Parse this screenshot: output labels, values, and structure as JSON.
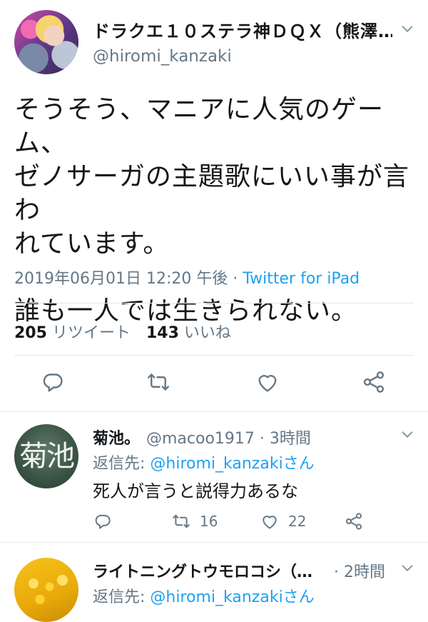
{
  "main_tweet": {
    "display_name": "ドラクエ１０ステラ神ＤＱＸ（熊澤…",
    "handle": "@hiromi_kanzaki",
    "text": "そうそう、マニアに人気のゲーム、\nゼノサーガの主題歌にいい事が言わ\nれています。\n\n誰も一人では生きられない。",
    "timestamp": "2019年06月01日 12:20 午後 · ",
    "source": "Twitter for iPad",
    "retweets_count": "205",
    "retweets_label": "リツイート",
    "likes_count": "143",
    "likes_label": "いいね",
    "actions": [
      "reply-icon",
      "retweet-icon",
      "like-icon",
      "share-icon"
    ]
  },
  "replies": [
    {
      "display_name": "菊池。",
      "handle_time": "@macoo1917 · 3時間",
      "reply_prefix": "返信先: ",
      "reply_mention": "@hiromi_kanzakiさん",
      "text": "死人が言うと説得力あるな",
      "avatar_text": "菊池",
      "retweets": "16",
      "likes": "22"
    },
    {
      "display_name": "ライトニングトウモロコシ（…",
      "handle_time": "· 2時間",
      "reply_prefix": "返信先: ",
      "reply_mention": "@hiromi_kanzakiさん"
    }
  ],
  "colors": {
    "text": "#14171a",
    "secondary": "#657786",
    "link": "#1da1f2",
    "divider": "#e1e8ed"
  }
}
